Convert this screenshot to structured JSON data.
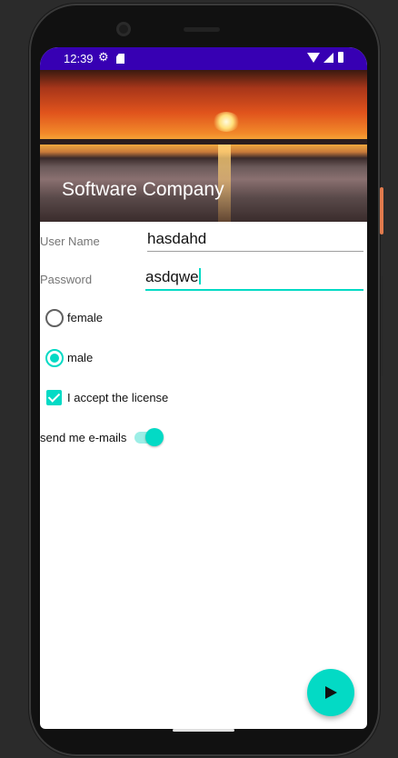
{
  "status_bar": {
    "time": "12:39",
    "icons": [
      "gear-icon",
      "sd-card-icon",
      "wifi-icon",
      "signal-icon",
      "battery-icon"
    ],
    "background": "#3700b3"
  },
  "header": {
    "title": "Software Company",
    "image": "sunset-over-water"
  },
  "form": {
    "username": {
      "label": "User Name",
      "value": "hasdahd"
    },
    "password": {
      "label": "Password",
      "value": "asdqwe"
    },
    "gender": {
      "options": [
        {
          "label": "female",
          "selected": false
        },
        {
          "label": "male",
          "selected": true
        }
      ]
    },
    "license": {
      "label": "I accept the license",
      "checked": true
    },
    "emails": {
      "label": "send me e-mails",
      "on": true
    }
  },
  "fab": {
    "icon": "send-icon"
  },
  "colors": {
    "accent": "#03dac5",
    "primary_dark": "#3700b3"
  }
}
